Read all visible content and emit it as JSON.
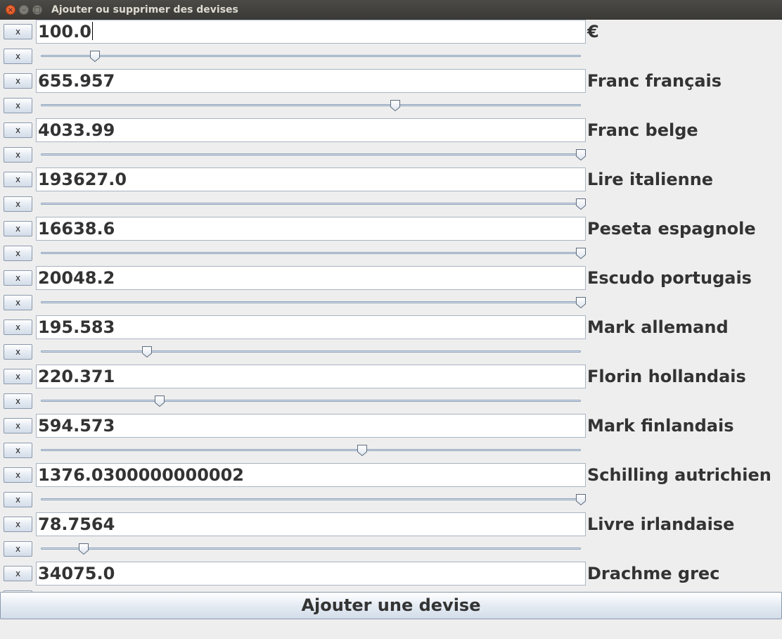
{
  "window": {
    "title": "Ajouter ou supprimer des devises",
    "close_glyph": "×",
    "minimize_glyph": "–",
    "maximize_glyph": "□"
  },
  "remove_label": "x",
  "rows": [
    {
      "value": "100.0",
      "label": "€",
      "slider_fraction": 0.1
    },
    {
      "value": "655.957",
      "label": "Franc français",
      "slider_fraction": 0.656
    },
    {
      "value": "4033.99",
      "label": "Franc belge",
      "slider_fraction": 1.0
    },
    {
      "value": "193627.0",
      "label": "Lire italienne",
      "slider_fraction": 1.0
    },
    {
      "value": "16638.6",
      "label": "Peseta espagnole",
      "slider_fraction": 1.0
    },
    {
      "value": "20048.2",
      "label": "Escudo portugais",
      "slider_fraction": 1.0
    },
    {
      "value": "195.583",
      "label": "Mark allemand",
      "slider_fraction": 0.196
    },
    {
      "value": "220.371",
      "label": "Florin hollandais",
      "slider_fraction": 0.22
    },
    {
      "value": "594.573",
      "label": "Mark finlandais",
      "slider_fraction": 0.595
    },
    {
      "value": "1376.0300000000002",
      "label": "Schilling autrichien",
      "slider_fraction": 1.0
    },
    {
      "value": "78.7564",
      "label": "Livre irlandaise",
      "slider_fraction": 0.079
    },
    {
      "value": "34075.0",
      "label": "Drachme grec",
      "slider_fraction": 1.0
    }
  ],
  "add_button_label": "Ajouter une devise"
}
